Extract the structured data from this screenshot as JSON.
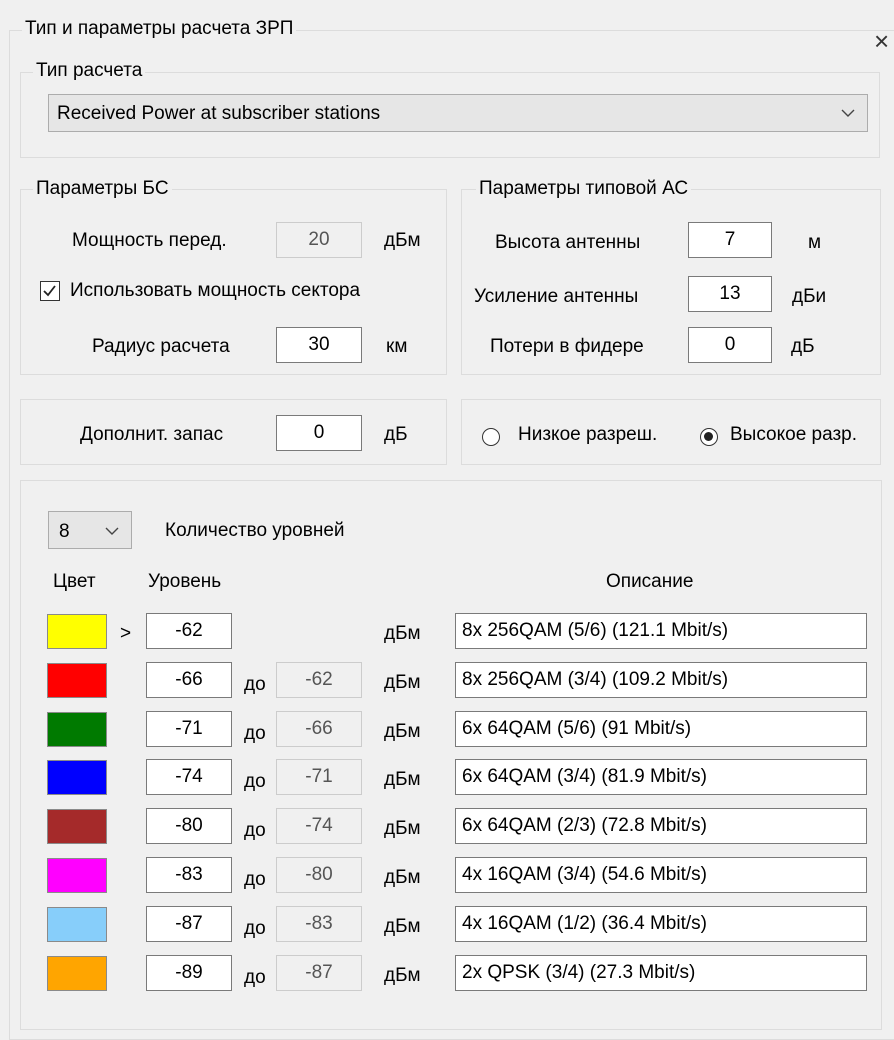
{
  "window": {
    "close_glyph": "×"
  },
  "calc_group": {
    "title": "Тип и параметры расчета ЗРП"
  },
  "calc_type": {
    "title": "Тип расчета",
    "selected": "Received Power at subscriber stations"
  },
  "bs": {
    "title": "Параметры БС",
    "power_label": "Мощность перед.",
    "power_value": "20",
    "power_unit": "дБм",
    "use_sector_power_label": "Использовать мощность сектора",
    "use_sector_power_checked": true,
    "radius_label": "Радиус расчета",
    "radius_value": "30",
    "radius_unit": "км"
  },
  "as": {
    "title": "Параметры типовой АС",
    "height_label": "Высота антенны",
    "height_value": "7",
    "height_unit": "м",
    "gain_label": "Усиление антенны",
    "gain_value": "13",
    "gain_unit": "дБи",
    "feeder_label": "Потери в фидере",
    "feeder_value": "0",
    "feeder_unit": "дБ"
  },
  "margin": {
    "label": "Дополнит. запас",
    "value": "0",
    "unit": "дБ"
  },
  "resolution": {
    "low_label": "Низкое разреш.",
    "high_label": "Высокое разр.",
    "selected": "high"
  },
  "levels": {
    "count_value": "8",
    "count_label": "Количество уровней",
    "col_color": "Цвет",
    "col_level": "Уровень",
    "col_desc": "Описание",
    "gt": ">",
    "to_label": "до",
    "unit": "дБм",
    "rows": [
      {
        "color": "#ffff00",
        "from": "-62",
        "to": "",
        "desc": "8x 256QAM (5/6) (121.1 Mbit/s)"
      },
      {
        "color": "#ff0000",
        "from": "-66",
        "to": "-62",
        "desc": "8x 256QAM (3/4) (109.2 Mbit/s)"
      },
      {
        "color": "#007a00",
        "from": "-71",
        "to": "-66",
        "desc": "6x 64QAM (5/6) (91 Mbit/s)"
      },
      {
        "color": "#0000ff",
        "from": "-74",
        "to": "-71",
        "desc": "6x 64QAM (3/4) (81.9 Mbit/s)"
      },
      {
        "color": "#a52a2a",
        "from": "-80",
        "to": "-74",
        "desc": "6x 64QAM (2/3) (72.8 Mbit/s)"
      },
      {
        "color": "#ff00ff",
        "from": "-83",
        "to": "-80",
        "desc": "4x 16QAM (3/4) (54.6 Mbit/s)"
      },
      {
        "color": "#87cefa",
        "from": "-87",
        "to": "-83",
        "desc": "4x 16QAM (1/2) (36.4 Mbit/s)"
      },
      {
        "color": "#ffa500",
        "from": "-89",
        "to": "-87",
        "desc": "2x QPSK (3/4) (27.3 Mbit/s)"
      }
    ]
  }
}
